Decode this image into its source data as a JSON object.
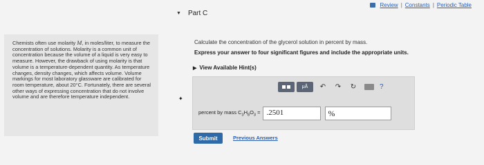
{
  "topbar": {
    "review": "Review",
    "sep1": "|",
    "constants": "Constants",
    "sep2": "|",
    "periodic_table": "Periodic Table"
  },
  "part": {
    "title": "Part C"
  },
  "passage": {
    "part1": "Chemists often use molarity ",
    "var": "M",
    "part2": ", in moles/liter, to measure the concentration of solutions. Molarity is a common unit of concentration because the volume of a liquid is very easy to measure. However, the drawback of using molarity is that volume is a temperature-dependent quantity. As temperature changes, density changes, which affects volume. Volume markings for most laboratory glassware are calibrated for room temperature, about 20°C. Fortunately, there are several other ways of expressing concentration that do not involve volume and are therefore temperature independent."
  },
  "question": {
    "text": "Calculate the concentration of the glycerol solution in percent by mass.",
    "instruction": "Express your answer to four significant figures and include the appropriate units.",
    "hints": "View Available Hint(s)"
  },
  "toolbar": {
    "mu_label": "μÅ",
    "undo": "↶",
    "redo": "↷",
    "reset": "↻",
    "help": "?"
  },
  "answer": {
    "label_prefix": "percent by mass C",
    "sub1": "3",
    "h": "H",
    "sub2": "8",
    "o": "O",
    "sub3": "3",
    "eq": " =",
    "value": ".2501",
    "unit": "%"
  },
  "actions": {
    "submit": "Submit",
    "previous": "Previous Answers"
  }
}
